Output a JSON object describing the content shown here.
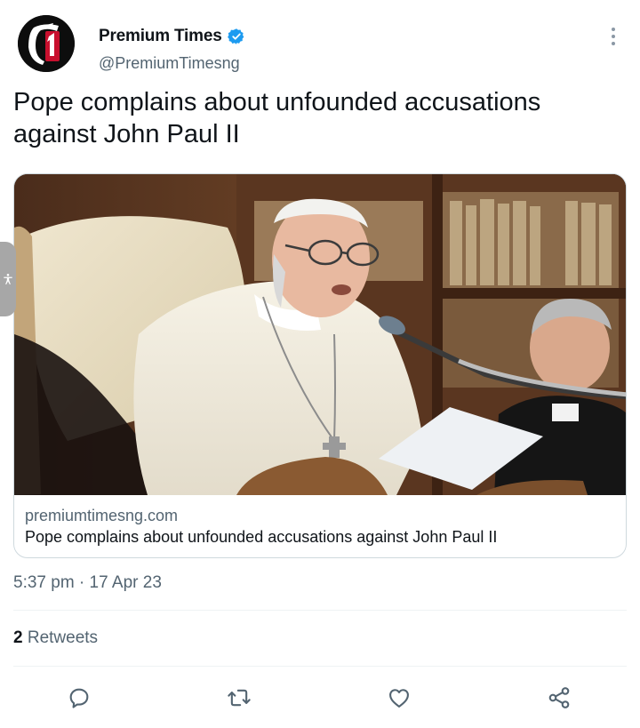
{
  "author": {
    "display_name": "Premium Times",
    "handle": "@PremiumTimesng",
    "verified": true,
    "avatar_icon": "premium-times-logo"
  },
  "tweet": {
    "text": "Pope complains about unfounded accusations against John Paul II"
  },
  "card": {
    "image_description_icon": "article-photo",
    "domain": "premiumtimesng.com",
    "title": "Pope complains about unfounded accusations against John Paul II"
  },
  "meta": {
    "timestamp": "5:37 pm · 17 Apr 23"
  },
  "stats": {
    "retweet_count": "2",
    "retweet_label": " Retweets"
  },
  "actions": [
    {
      "name": "reply",
      "icon": "speech-bubble-icon"
    },
    {
      "name": "retweet",
      "icon": "retweet-arrows-icon"
    },
    {
      "name": "like",
      "icon": "heart-icon"
    },
    {
      "name": "share",
      "icon": "share-icon"
    }
  ],
  "colors": {
    "verified_blue": "#1d9bf0",
    "secondary_text": "#536471",
    "primary_text": "#0f1419",
    "border": "#cfd9de"
  }
}
